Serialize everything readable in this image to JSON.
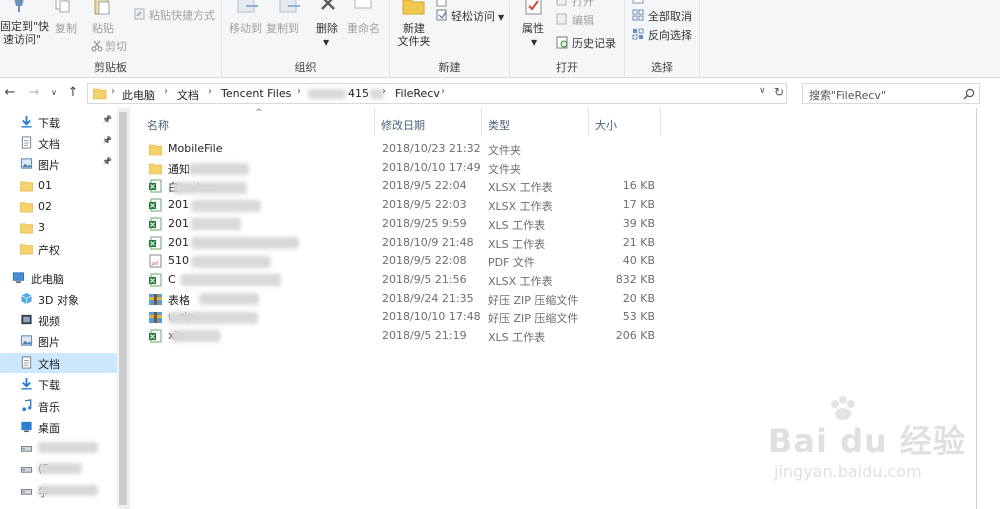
{
  "ribbon": {
    "clipboard": {
      "pin_label_line1": "固定到\"快",
      "pin_label_line2": "速访问\"",
      "copy_label": "复制",
      "paste_label": "粘贴",
      "paste_shortcut_label": "粘贴快捷方式",
      "cut_label": "剪切",
      "group_label": "剪贴板"
    },
    "organize": {
      "move_to_label": "移动到",
      "copy_to_label": "复制到",
      "delete_label": "删除",
      "rename_label": "重命名",
      "group_label": "组织"
    },
    "new": {
      "new_folder_line1": "新建",
      "new_folder_line2": "文件夹",
      "easy_access_label": "轻松访问",
      "group_label": "新建"
    },
    "open": {
      "properties_label": "属性",
      "open_label": "打开",
      "edit_label": "编辑",
      "history_label": "历史记录",
      "group_label": "打开"
    },
    "select": {
      "select_none_label": "全部取消",
      "invert_label": "反向选择",
      "group_label": "选择"
    }
  },
  "address": {
    "breadcrumbs": [
      "此电脑",
      "文档",
      "Tencent Files",
      "415",
      "FileRecv"
    ],
    "search_placeholder": "搜索\"FileRecv\""
  },
  "nav": {
    "items": [
      {
        "label": "下载",
        "icon": "download-arrow-icon",
        "pinned": true
      },
      {
        "label": "文档",
        "icon": "document-icon",
        "pinned": true
      },
      {
        "label": "图片",
        "icon": "picture-icon",
        "pinned": true
      },
      {
        "label": "01",
        "icon": "folder-icon",
        "pinned": false
      },
      {
        "label": "02",
        "icon": "folder-icon",
        "pinned": false
      },
      {
        "label": "3",
        "icon": "folder-icon",
        "pinned": false
      },
      {
        "label": "产权",
        "icon": "folder-icon",
        "pinned": false
      },
      {
        "label": "此电脑",
        "icon": "computer-icon",
        "pinned": false
      },
      {
        "label": "3D 对象",
        "icon": "cube-3d-icon",
        "pinned": false
      },
      {
        "label": "视频",
        "icon": "video-icon",
        "pinned": false
      },
      {
        "label": "图片",
        "icon": "picture-icon",
        "pinned": false
      },
      {
        "label": "文档",
        "icon": "document-icon",
        "pinned": false
      },
      {
        "label": "下载",
        "icon": "download-arrow-icon",
        "pinned": false
      },
      {
        "label": "音乐",
        "icon": "music-note-icon",
        "pinned": false
      },
      {
        "label": "桌面",
        "icon": "desktop-icon",
        "pinned": false
      },
      {
        "label": "",
        "icon": "drive-icon",
        "pinned": false
      },
      {
        "label": "(F",
        "icon": "drive-icon",
        "pinned": false
      },
      {
        "label": "学",
        "icon": "drive-icon",
        "pinned": false
      }
    ]
  },
  "columns": {
    "name": "名称",
    "date": "修改日期",
    "type": "类型",
    "size": "大小"
  },
  "files": [
    {
      "name": "MobileFile",
      "date": "2018/10/23 21:32",
      "type": "文件夹",
      "size": "",
      "icon": "folder-icon"
    },
    {
      "name": "通知",
      "date": "2018/10/10 17:49",
      "type": "文件夹",
      "size": "",
      "icon": "folder-icon"
    },
    {
      "name": "白) .xlsx",
      "date": "2018/9/5 22:04",
      "type": "XLSX 工作表",
      "size": "16 KB",
      "icon": "excel-icon"
    },
    {
      "name": "201",
      "date": "2018/9/5 22:03",
      "type": "XLSX 工作表",
      "size": "17 KB",
      "icon": "excel-icon"
    },
    {
      "name": "201",
      "date": "2018/9/25 9:59",
      "type": "XLS 工作表",
      "size": "39 KB",
      "icon": "excel-icon"
    },
    {
      "name": "201",
      "date": "2018/10/9 21:48",
      "type": "XLS 工作表",
      "size": "21 KB",
      "icon": "excel-icon"
    },
    {
      "name": "510",
      "date": "2018/9/5 22:08",
      "type": "PDF 文件",
      "size": "40 KB",
      "icon": "pdf-icon"
    },
    {
      "name": "C",
      "date": "2018/9/5 21:56",
      "type": "XLSX 工作表",
      "size": "832 KB",
      "icon": "excel-icon"
    },
    {
      "name": "表格",
      "date": "2018/9/24 21:35",
      "type": "好压 ZIP 压缩文件",
      "size": "20 KB",
      "icon": "zip-archive-icon"
    },
    {
      "name": "u.zip",
      "date": "2018/10/10 17:48",
      "type": "好压 ZIP 压缩文件",
      "size": "53 KB",
      "icon": "zip-archive-icon"
    },
    {
      "name": "xls",
      "date": "2018/9/5 21:19",
      "type": "XLS 工作表",
      "size": "206 KB",
      "icon": "excel-icon"
    }
  ],
  "watermark": {
    "brand": "Bai du 经验",
    "url": "jingyan.baidu.com"
  }
}
